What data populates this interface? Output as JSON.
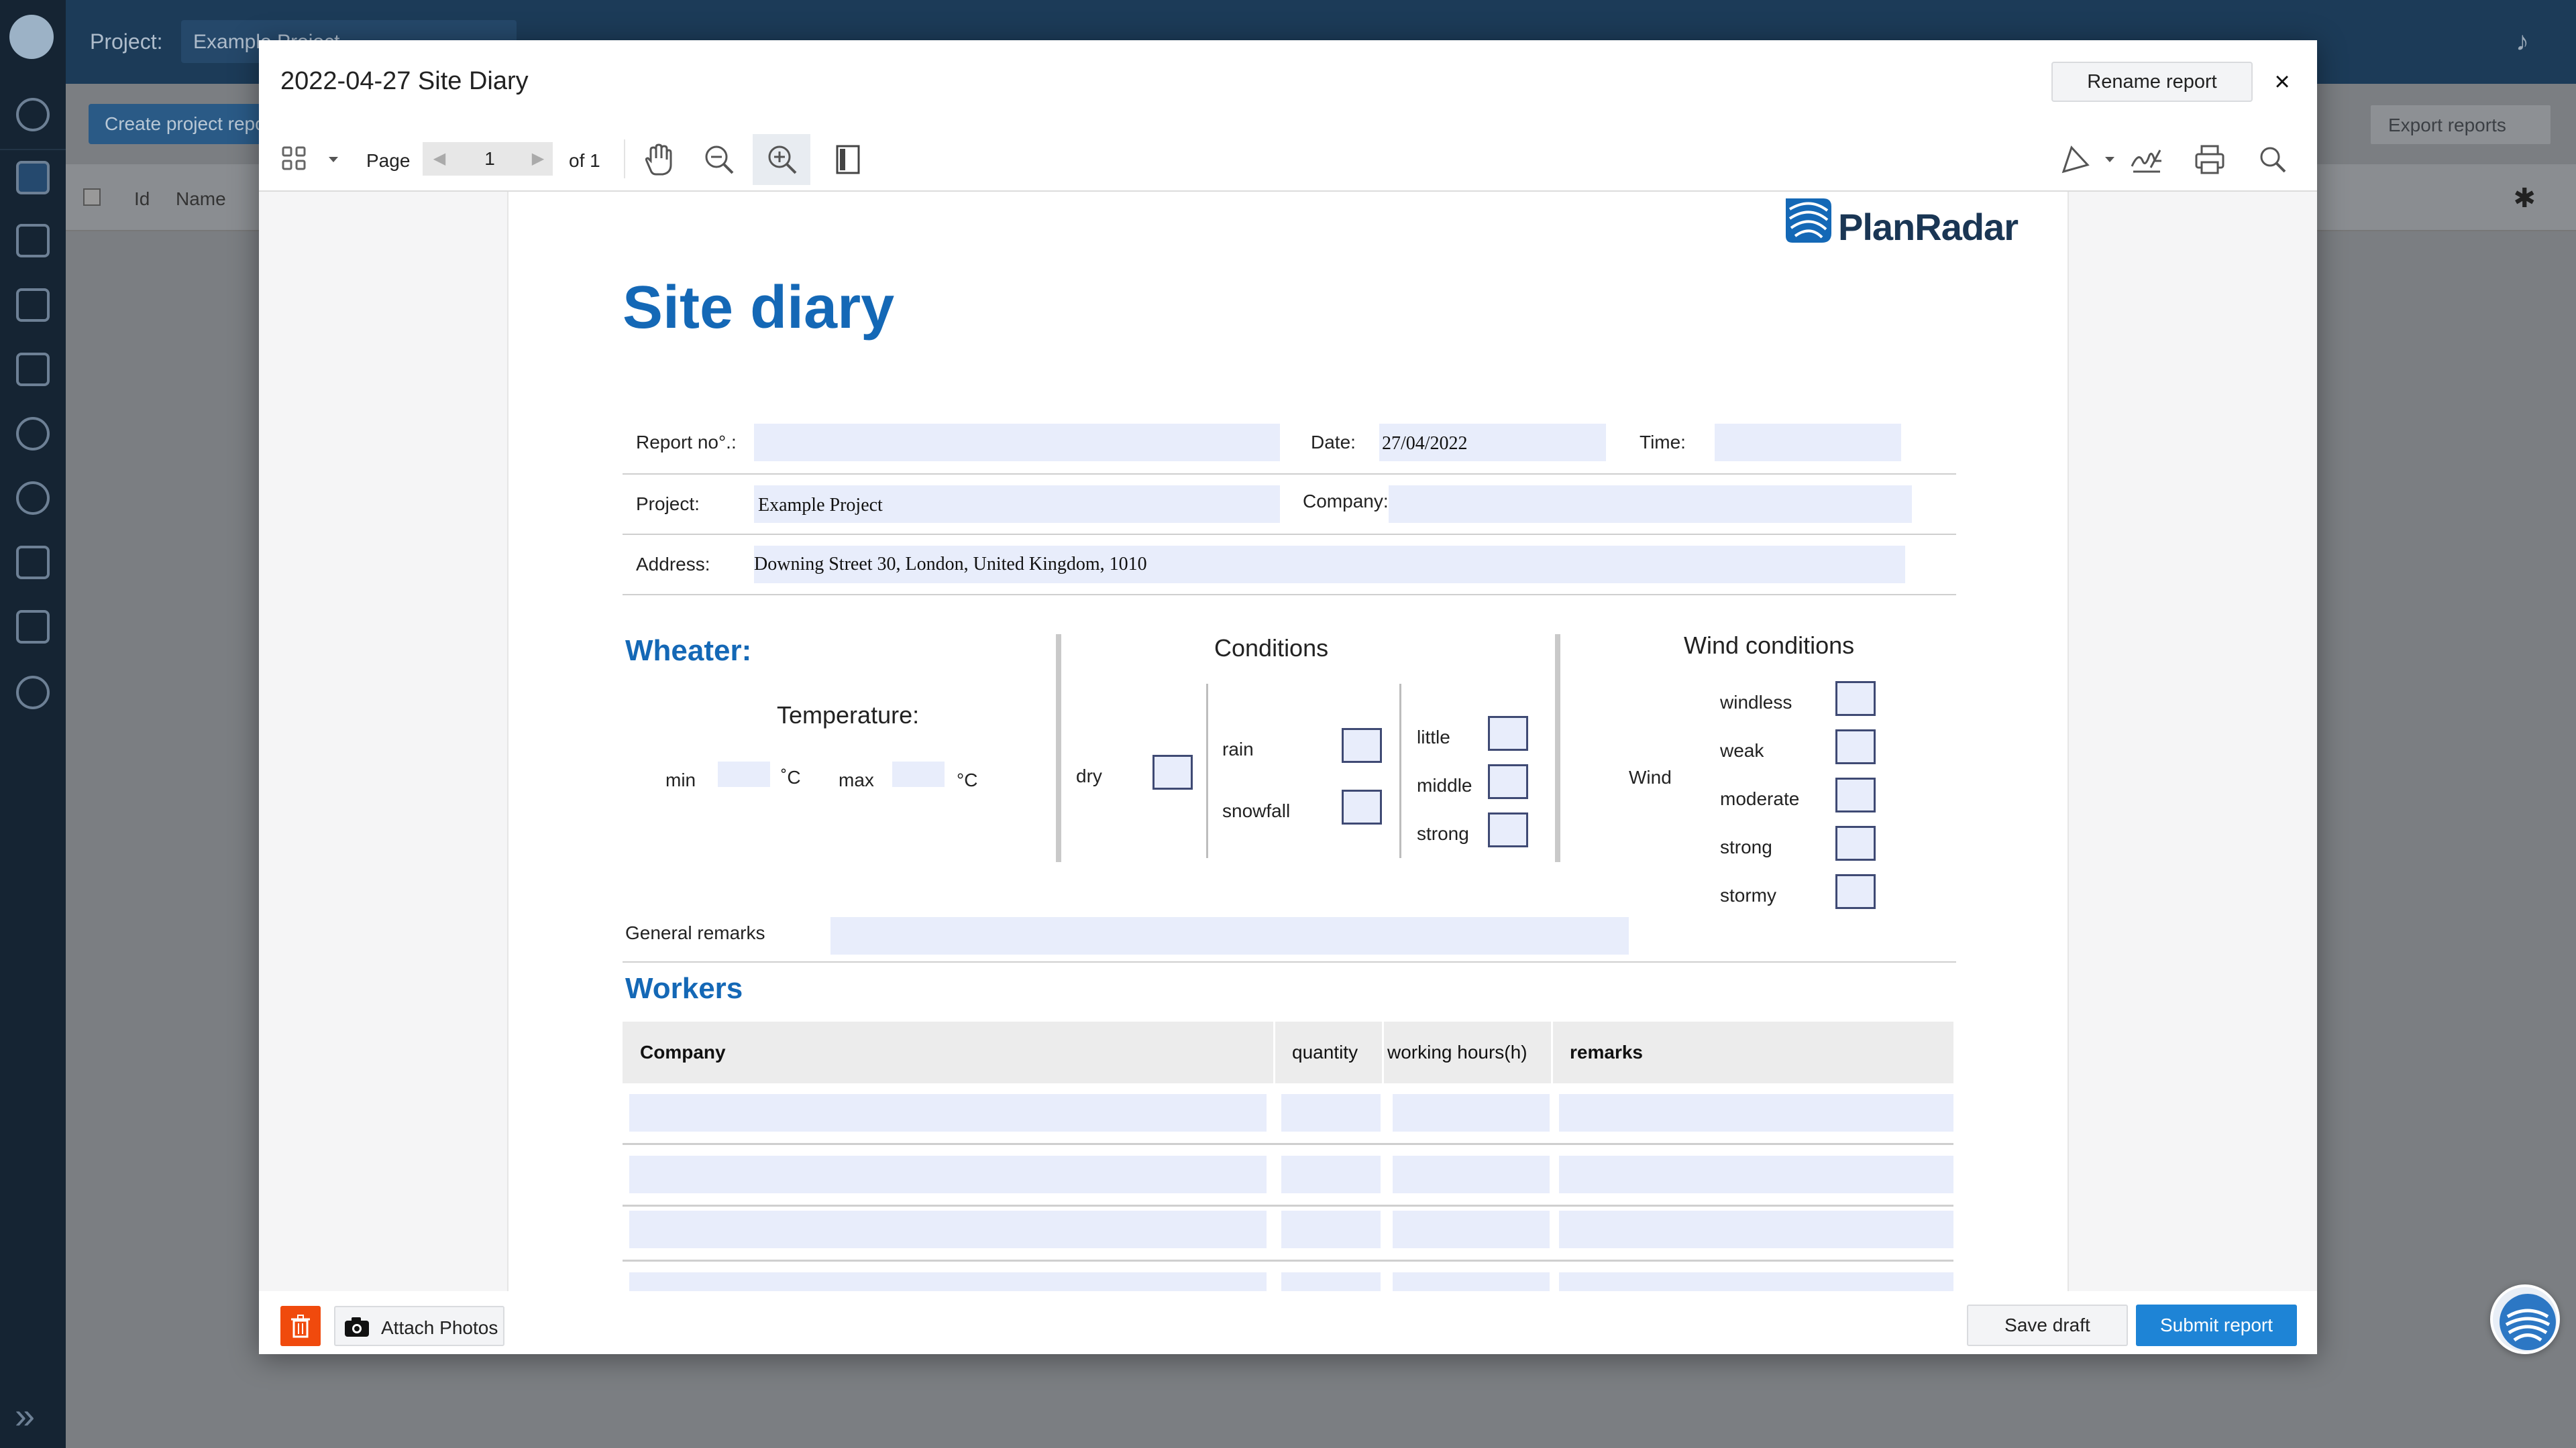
{
  "app": {
    "project_label": "Project:",
    "project_value": "Example Project",
    "create_button": "Create project reports",
    "export_button": "Export reports",
    "table_columns": [
      "Id",
      "Name"
    ]
  },
  "modal": {
    "title": "2022-04-27 Site Diary",
    "rename_button": "Rename report",
    "close_glyph": "×"
  },
  "toolbar": {
    "page_label": "Page",
    "page_current": "1",
    "page_total": "of 1",
    "icons": [
      "thumbnails-icon",
      "hand-icon",
      "zoom-out-icon",
      "zoom-in-icon",
      "single-page-icon",
      "annotate-icon",
      "signature-icon",
      "print-icon",
      "search-icon"
    ]
  },
  "document": {
    "brand": "PlanRadar",
    "title": "Site diary",
    "report_no_label": "Report no°.:",
    "date_label": "Date:",
    "date_value": "27/04/2022",
    "time_label": "Time:",
    "project_label": "Project:",
    "project_value": "Example Project",
    "company_label": "Company:",
    "address_label": "Address:",
    "address_value": "Downing Street 30, London, United Kingdom, 1010",
    "weather": {
      "section": "Wheater:",
      "temperature": "Temperature:",
      "min": "min",
      "max": "max",
      "unit_min": "˚C",
      "unit_max": "°C",
      "conditions": "Conditions",
      "dry": "dry",
      "rain": "rain",
      "snowfall": "snowfall",
      "little": "little",
      "middle": "middle",
      "strong": "strong",
      "wind_conditions": "Wind conditions",
      "wind": "Wind",
      "wind_levels": [
        "windless",
        "weak",
        "moderate",
        "strong",
        "stormy"
      ],
      "general_remarks": "General remarks"
    },
    "workers": {
      "section": "Workers",
      "columns": [
        "Company",
        "quantity",
        "working hours(h)",
        "remarks"
      ]
    }
  },
  "footer": {
    "attach": "Attach Photos",
    "save": "Save draft",
    "submit": "Submit report"
  },
  "colors": {
    "accent": "#1468b6",
    "field": "#e8edfb",
    "primary_button": "#1e84d6",
    "delete_button": "#f04a0d"
  }
}
